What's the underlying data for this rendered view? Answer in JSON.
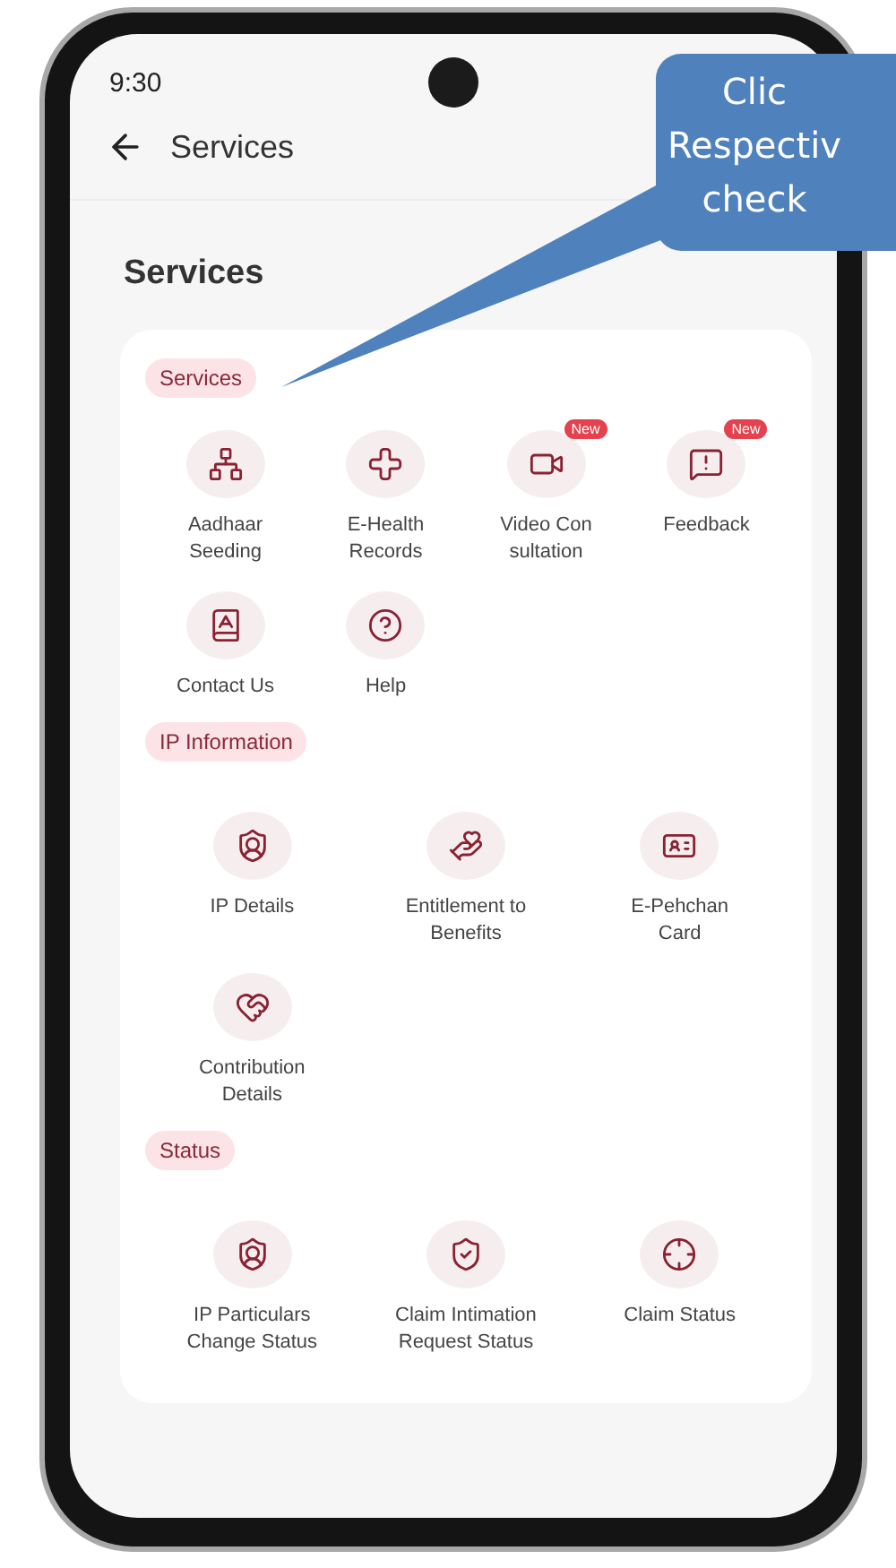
{
  "status_bar": {
    "time": "9:30"
  },
  "app_bar": {
    "title": "Services"
  },
  "page_heading": "Services",
  "sections": [
    {
      "title": "Services",
      "items": [
        {
          "label": "Aadhaar Seeding"
        },
        {
          "label": "E-Health Records"
        },
        {
          "label": "Video Con sultation",
          "badge": "New"
        },
        {
          "label": "Feedback",
          "badge": "New"
        },
        {
          "label": "Contact Us"
        },
        {
          "label": "Help"
        }
      ]
    },
    {
      "title": "IP Information",
      "items": [
        {
          "label": "IP Details"
        },
        {
          "label": "Entitlement to Benefits"
        },
        {
          "label": "E-Pehchan Card"
        },
        {
          "label": "Contribution Details"
        }
      ]
    },
    {
      "title": "Status",
      "items": [
        {
          "label": "IP Particulars Change Status"
        },
        {
          "label": "Claim Intimation Request Status"
        },
        {
          "label": "Claim Status"
        }
      ]
    }
  ],
  "callout": {
    "lines": [
      "Clic",
      "Respectiv",
      "check"
    ]
  }
}
